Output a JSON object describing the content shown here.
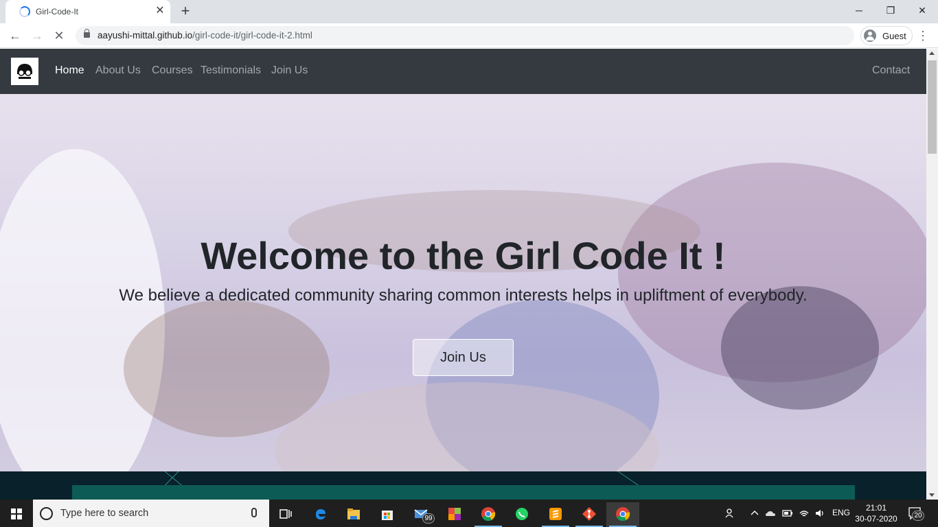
{
  "browser": {
    "tab_title": "Girl-Code-It",
    "new_tab_symbol": "+",
    "close_tab_symbol": "✕",
    "url_host": "aayushi-mittal.github.io",
    "url_path": "/girl-code-it/girl-code-it-2.html",
    "profile_name": "Guest",
    "window_controls": {
      "minimize": "─",
      "restore": "❐",
      "close": "✕"
    },
    "nav_symbols": {
      "back": "←",
      "forward": "→",
      "stop": "✕",
      "menu": "⋮"
    }
  },
  "site": {
    "nav": {
      "items": [
        {
          "label": "Home",
          "active": true
        },
        {
          "label": "About Us",
          "active": false
        },
        {
          "label": "Courses",
          "active": false
        },
        {
          "label": "Testimonials",
          "active": false
        },
        {
          "label": "Join Us",
          "active": false
        }
      ],
      "contact_label": "Contact"
    },
    "hero": {
      "title": "Welcome to the Girl Code It !",
      "subtitle": "We believe a dedicated community sharing common interests helps in upliftment of everybody.",
      "button_label": "Join Us"
    }
  },
  "taskbar": {
    "search_placeholder": "Type here to search",
    "mail_badge": "99",
    "language": "ENG",
    "time": "21:01",
    "date": "30-07-2020",
    "notification_count": "20",
    "apps": [
      "task-view",
      "edge",
      "file-explorer",
      "store",
      "mail",
      "office",
      "chrome",
      "whatsapp",
      "sublime-text",
      "git",
      "chrome-active"
    ]
  },
  "colors": {
    "site_nav_bg": "#343a40",
    "chrome_accent": "#1a73e8",
    "taskbar_bg": "#1f1f1f"
  }
}
